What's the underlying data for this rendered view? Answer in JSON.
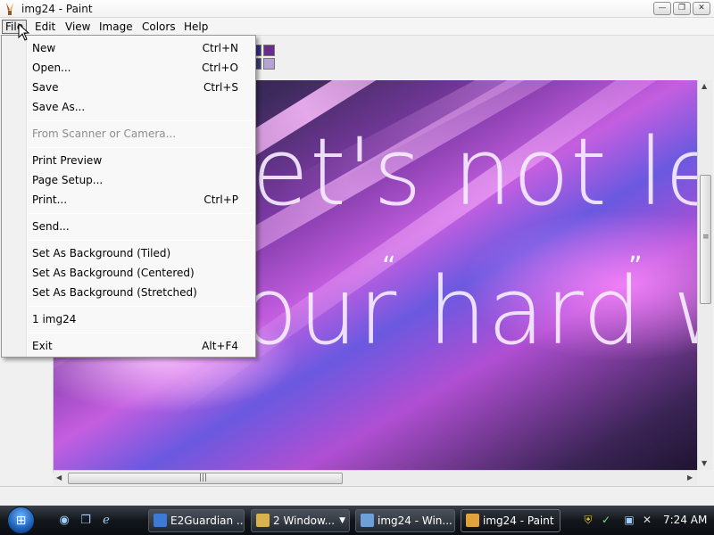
{
  "window": {
    "title": "img24 - Paint",
    "controls": {
      "minimize": "—",
      "restore": "❐",
      "close": "✕"
    }
  },
  "menubar": {
    "items": [
      {
        "label": "File",
        "active": true
      },
      {
        "label": "Edit"
      },
      {
        "label": "View"
      },
      {
        "label": "Image"
      },
      {
        "label": "Colors"
      },
      {
        "label": "Help"
      }
    ]
  },
  "file_menu": {
    "items": [
      {
        "label": "New",
        "shortcut": "Ctrl+N"
      },
      {
        "label": "Open...",
        "shortcut": "Ctrl+O"
      },
      {
        "label": "Save",
        "shortcut": "Ctrl+S"
      },
      {
        "label": "Save As...",
        "shortcut": ""
      },
      {
        "label": "From Scanner or Camera...",
        "shortcut": "",
        "disabled": true
      },
      {
        "label": "Print Preview",
        "shortcut": ""
      },
      {
        "label": "Page Setup...",
        "shortcut": ""
      },
      {
        "label": "Print...",
        "shortcut": "Ctrl+P"
      },
      {
        "label": "Send...",
        "shortcut": ""
      },
      {
        "label": "Set As Background (Tiled)",
        "shortcut": ""
      },
      {
        "label": "Set As Background (Centered)",
        "shortcut": ""
      },
      {
        "label": "Set As Background (Stretched)",
        "shortcut": ""
      },
      {
        "label": "1 img24",
        "shortcut": ""
      },
      {
        "label": "Exit",
        "shortcut": "Alt+F4"
      }
    ]
  },
  "palette": {
    "colors": [
      "#3a2f8f",
      "#6a2c8f",
      "#3f3f7a",
      "#b5a3d6"
    ]
  },
  "canvas": {
    "line1": "et's not le",
    "line2": "our hard w",
    "open_quote": "“",
    "close_quote": "”",
    "colors": {
      "deep": "#2a1b3a",
      "magenta": "#c45ee0",
      "violet": "#6a59e0",
      "pink": "#ff8cff"
    }
  },
  "taskbar": {
    "start_label": "⊞",
    "quicklaunch": [
      "ie-globe-icon",
      "switch-windows-icon",
      "internet-explorer-icon"
    ],
    "buttons": [
      {
        "label": "E2Guardian ...",
        "icon_color": "#3b7bd6"
      },
      {
        "label": "2 Window...",
        "icon_color": "#d8b24a"
      },
      {
        "label": "img24 - Win...",
        "icon_color": "#6ba0d8"
      },
      {
        "label": "img24 - Paint",
        "icon_color": "#e0a23a"
      }
    ],
    "clock": "7:24 AM",
    "tray_icons": [
      "shield-warning-icon",
      "network-icon",
      "speaker-muted-icon"
    ]
  },
  "scrollbars": {
    "hgrip": "|||",
    "vgrip": "≡"
  }
}
